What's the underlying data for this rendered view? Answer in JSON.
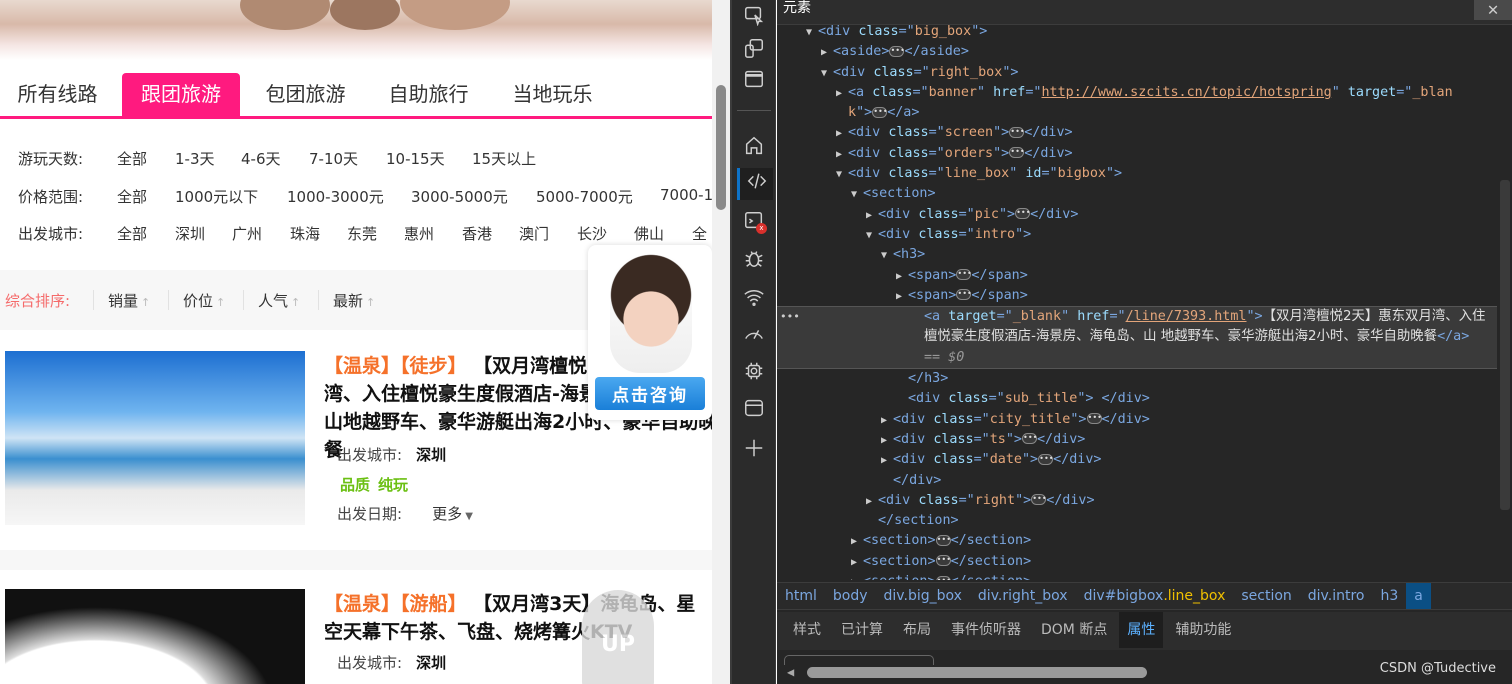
{
  "page": {
    "tabs": [
      "所有线路",
      "跟团旅游",
      "包团旅游",
      "自助旅行",
      "当地玩乐"
    ],
    "active_tab": 1,
    "filters": [
      {
        "label": "游玩天数:",
        "options": [
          "全部",
          "1-3天",
          "4-6天",
          "7-10天",
          "10-15天",
          "15天以上"
        ]
      },
      {
        "label": "价格范围:",
        "options": [
          "全部",
          "1000元以下",
          "1000-3000元",
          "3000-5000元",
          "5000-7000元",
          "7000-1"
        ]
      },
      {
        "label": "出发城市:",
        "options": [
          "全部",
          "深圳",
          "广州",
          "珠海",
          "东莞",
          "惠州",
          "香港",
          "澳门",
          "长沙",
          "佛山",
          "全"
        ]
      }
    ],
    "sort": {
      "label": "综合排序:",
      "items": [
        "销量",
        "价位",
        "人气",
        "最新"
      ],
      "arrow": "↑"
    },
    "cards": [
      {
        "tags": [
          "【温泉】",
          "【徒步】"
        ],
        "title": "【双月湾檀悦2天】惠东双月湾、入住檀悦豪生度假酒店-海景房、海龟岛、山地越野车、豪华游艇出海2小时、豪华自助晚餐",
        "city_label": "出发城市:",
        "city": "深圳",
        "features": [
          "品质",
          "纯玩"
        ],
        "date_label": "出发日期:",
        "more": "更多"
      },
      {
        "tags": [
          "【温泉】",
          "【游船】"
        ],
        "title": "【双月湾3天】海龟岛、星空天幕下午茶、飞盘、烧烤篝火KTV",
        "city_label": "出发城市:",
        "city": "深圳"
      }
    ],
    "consult_button": "点击咨询",
    "up_label": "UP"
  },
  "devtools": {
    "title": "元素",
    "lines": [
      {
        "i": 0,
        "a": "open",
        "tok": [
          [
            "t",
            "<div "
          ],
          [
            "an",
            "class"
          ],
          [
            "t",
            "=\""
          ],
          [
            "av",
            "big_box"
          ],
          [
            "t",
            "\">"
          ]
        ]
      },
      {
        "i": 1,
        "a": "closed",
        "tok": [
          [
            "t",
            "<aside>"
          ],
          [
            "d",
            ""
          ],
          [
            "t",
            "</aside>"
          ]
        ]
      },
      {
        "i": 1,
        "a": "open",
        "tok": [
          [
            "t",
            "<div "
          ],
          [
            "an",
            "class"
          ],
          [
            "t",
            "=\""
          ],
          [
            "av",
            "right_box"
          ],
          [
            "t",
            "\">"
          ]
        ]
      },
      {
        "i": 2,
        "a": "closed",
        "tok": [
          [
            "t",
            "<a "
          ],
          [
            "an",
            "class"
          ],
          [
            "t",
            "=\""
          ],
          [
            "av",
            "banner"
          ],
          [
            "t",
            "\" "
          ],
          [
            "an",
            "href"
          ],
          [
            "t",
            "=\""
          ],
          [
            "url",
            "http://www.szcits.cn/topic/hotspring"
          ],
          [
            "t",
            "\" "
          ],
          [
            "an",
            "target"
          ],
          [
            "t",
            "=\""
          ],
          [
            "av",
            "_blan"
          ]
        ]
      },
      {
        "i": 2,
        "a": "none",
        "tok": [
          [
            "av",
            "k"
          ],
          [
            "t",
            "\">"
          ],
          [
            "d",
            ""
          ],
          [
            "t",
            "</a>"
          ]
        ]
      },
      {
        "i": 2,
        "a": "closed",
        "tok": [
          [
            "t",
            "<div "
          ],
          [
            "an",
            "class"
          ],
          [
            "t",
            "=\""
          ],
          [
            "av",
            "screen"
          ],
          [
            "t",
            "\">"
          ],
          [
            "d",
            ""
          ],
          [
            "t",
            "</div>"
          ]
        ]
      },
      {
        "i": 2,
        "a": "closed",
        "tok": [
          [
            "t",
            "<div "
          ],
          [
            "an",
            "class"
          ],
          [
            "t",
            "=\""
          ],
          [
            "av",
            "orders"
          ],
          [
            "t",
            "\">"
          ],
          [
            "d",
            ""
          ],
          [
            "t",
            "</div>"
          ]
        ]
      },
      {
        "i": 2,
        "a": "open",
        "tok": [
          [
            "t",
            "<div "
          ],
          [
            "an",
            "class"
          ],
          [
            "t",
            "=\""
          ],
          [
            "av",
            "line_box"
          ],
          [
            "t",
            "\" "
          ],
          [
            "an",
            "id"
          ],
          [
            "t",
            "=\""
          ],
          [
            "av",
            "bigbox"
          ],
          [
            "t",
            "\">"
          ]
        ]
      },
      {
        "i": 3,
        "a": "open",
        "tok": [
          [
            "t",
            "<section>"
          ]
        ]
      },
      {
        "i": 4,
        "a": "closed",
        "tok": [
          [
            "t",
            "<div "
          ],
          [
            "an",
            "class"
          ],
          [
            "t",
            "=\""
          ],
          [
            "av",
            "pic"
          ],
          [
            "t",
            "\">"
          ],
          [
            "d",
            ""
          ],
          [
            "t",
            "</div>"
          ]
        ]
      },
      {
        "i": 4,
        "a": "open",
        "tok": [
          [
            "t",
            "<div "
          ],
          [
            "an",
            "class"
          ],
          [
            "t",
            "=\""
          ],
          [
            "av",
            "intro"
          ],
          [
            "t",
            "\">"
          ]
        ]
      },
      {
        "i": 5,
        "a": "open",
        "tok": [
          [
            "t",
            "<h3>"
          ]
        ]
      },
      {
        "i": 6,
        "a": "closed",
        "tok": [
          [
            "t",
            "<span>"
          ],
          [
            "d",
            ""
          ],
          [
            "t",
            "</span>"
          ]
        ]
      },
      {
        "i": 6,
        "a": "closed",
        "tok": [
          [
            "t",
            "<span>"
          ],
          [
            "d",
            ""
          ],
          [
            "t",
            "</span>"
          ]
        ]
      },
      {
        "i": 7,
        "a": "sel",
        "tok": [
          [
            "t",
            "<a "
          ],
          [
            "an",
            "target"
          ],
          [
            "t",
            "=\""
          ],
          [
            "av",
            "_blank"
          ],
          [
            "t",
            "\" "
          ],
          [
            "an",
            "href"
          ],
          [
            "t",
            "=\""
          ],
          [
            "url",
            "/line/7393.html"
          ],
          [
            "t",
            "\">"
          ],
          [
            "tx",
            "【双月湾檀悦2天】惠东双月湾、入住檀悦豪生度假酒店-海景房、海龟岛、山 地越野车、豪华游艇出海2小时、豪华自助晚餐"
          ],
          [
            "t",
            "</a>"
          ],
          [
            "eq",
            " == $0"
          ]
        ]
      },
      {
        "i": 6,
        "a": "none",
        "tok": [
          [
            "t",
            "</h3>"
          ]
        ]
      },
      {
        "i": 6,
        "a": "none",
        "tok": [
          [
            "t",
            "<div "
          ],
          [
            "an",
            "class"
          ],
          [
            "t",
            "=\""
          ],
          [
            "av",
            "sub_title"
          ],
          [
            "t",
            "\"> </div>"
          ]
        ]
      },
      {
        "i": 5,
        "a": "closed",
        "tok": [
          [
            "t",
            "<div "
          ],
          [
            "an",
            "class"
          ],
          [
            "t",
            "=\""
          ],
          [
            "av",
            "city_title"
          ],
          [
            "t",
            "\">"
          ],
          [
            "d",
            ""
          ],
          [
            "t",
            "</div>"
          ]
        ]
      },
      {
        "i": 5,
        "a": "closed",
        "tok": [
          [
            "t",
            "<div "
          ],
          [
            "an",
            "class"
          ],
          [
            "t",
            "=\""
          ],
          [
            "av",
            "ts"
          ],
          [
            "t",
            "\">"
          ],
          [
            "d",
            ""
          ],
          [
            "t",
            "</div>"
          ]
        ]
      },
      {
        "i": 5,
        "a": "closed",
        "tok": [
          [
            "t",
            "<div "
          ],
          [
            "an",
            "class"
          ],
          [
            "t",
            "=\""
          ],
          [
            "av",
            "date"
          ],
          [
            "t",
            "\">"
          ],
          [
            "d",
            ""
          ],
          [
            "t",
            "</div>"
          ]
        ]
      },
      {
        "i": 5,
        "a": "none",
        "tok": [
          [
            "t",
            "</div>"
          ]
        ]
      },
      {
        "i": 4,
        "a": "closed",
        "tok": [
          [
            "t",
            "<div "
          ],
          [
            "an",
            "class"
          ],
          [
            "t",
            "=\""
          ],
          [
            "av",
            "right"
          ],
          [
            "t",
            "\">"
          ],
          [
            "d",
            ""
          ],
          [
            "t",
            "</div>"
          ]
        ]
      },
      {
        "i": 4,
        "a": "none",
        "tok": [
          [
            "t",
            "</section>"
          ]
        ]
      },
      {
        "i": 3,
        "a": "closed",
        "tok": [
          [
            "t",
            "<section>"
          ],
          [
            "d",
            ""
          ],
          [
            "t",
            "</section>"
          ]
        ]
      },
      {
        "i": 3,
        "a": "closed",
        "tok": [
          [
            "t",
            "<section>"
          ],
          [
            "d",
            ""
          ],
          [
            "t",
            "</section>"
          ]
        ]
      },
      {
        "i": 3,
        "a": "closed",
        "tok": [
          [
            "t",
            "<section>"
          ],
          [
            "d",
            ""
          ],
          [
            "t",
            "</section>"
          ]
        ]
      }
    ],
    "breadcrumbs": [
      [
        "html"
      ],
      [
        "body"
      ],
      [
        "div.big_box"
      ],
      [
        "div.right_box"
      ],
      [
        "div#bigbox",
        ".line_box"
      ],
      [
        "section"
      ],
      [
        "div.intro"
      ],
      [
        "h3"
      ],
      [
        "a"
      ]
    ],
    "bottom_tabs": [
      "样式",
      "已计算",
      "布局",
      "事件侦听器",
      "DOM 断点",
      "属性",
      "辅助功能"
    ],
    "active_bottom_tab": 5,
    "watermark": "CSDN @Tudective"
  },
  "colors": {
    "accent": "#ff1a7f",
    "tag": "#f5712a",
    "feature": "#6bc013",
    "consult": "#1a7fd8"
  }
}
